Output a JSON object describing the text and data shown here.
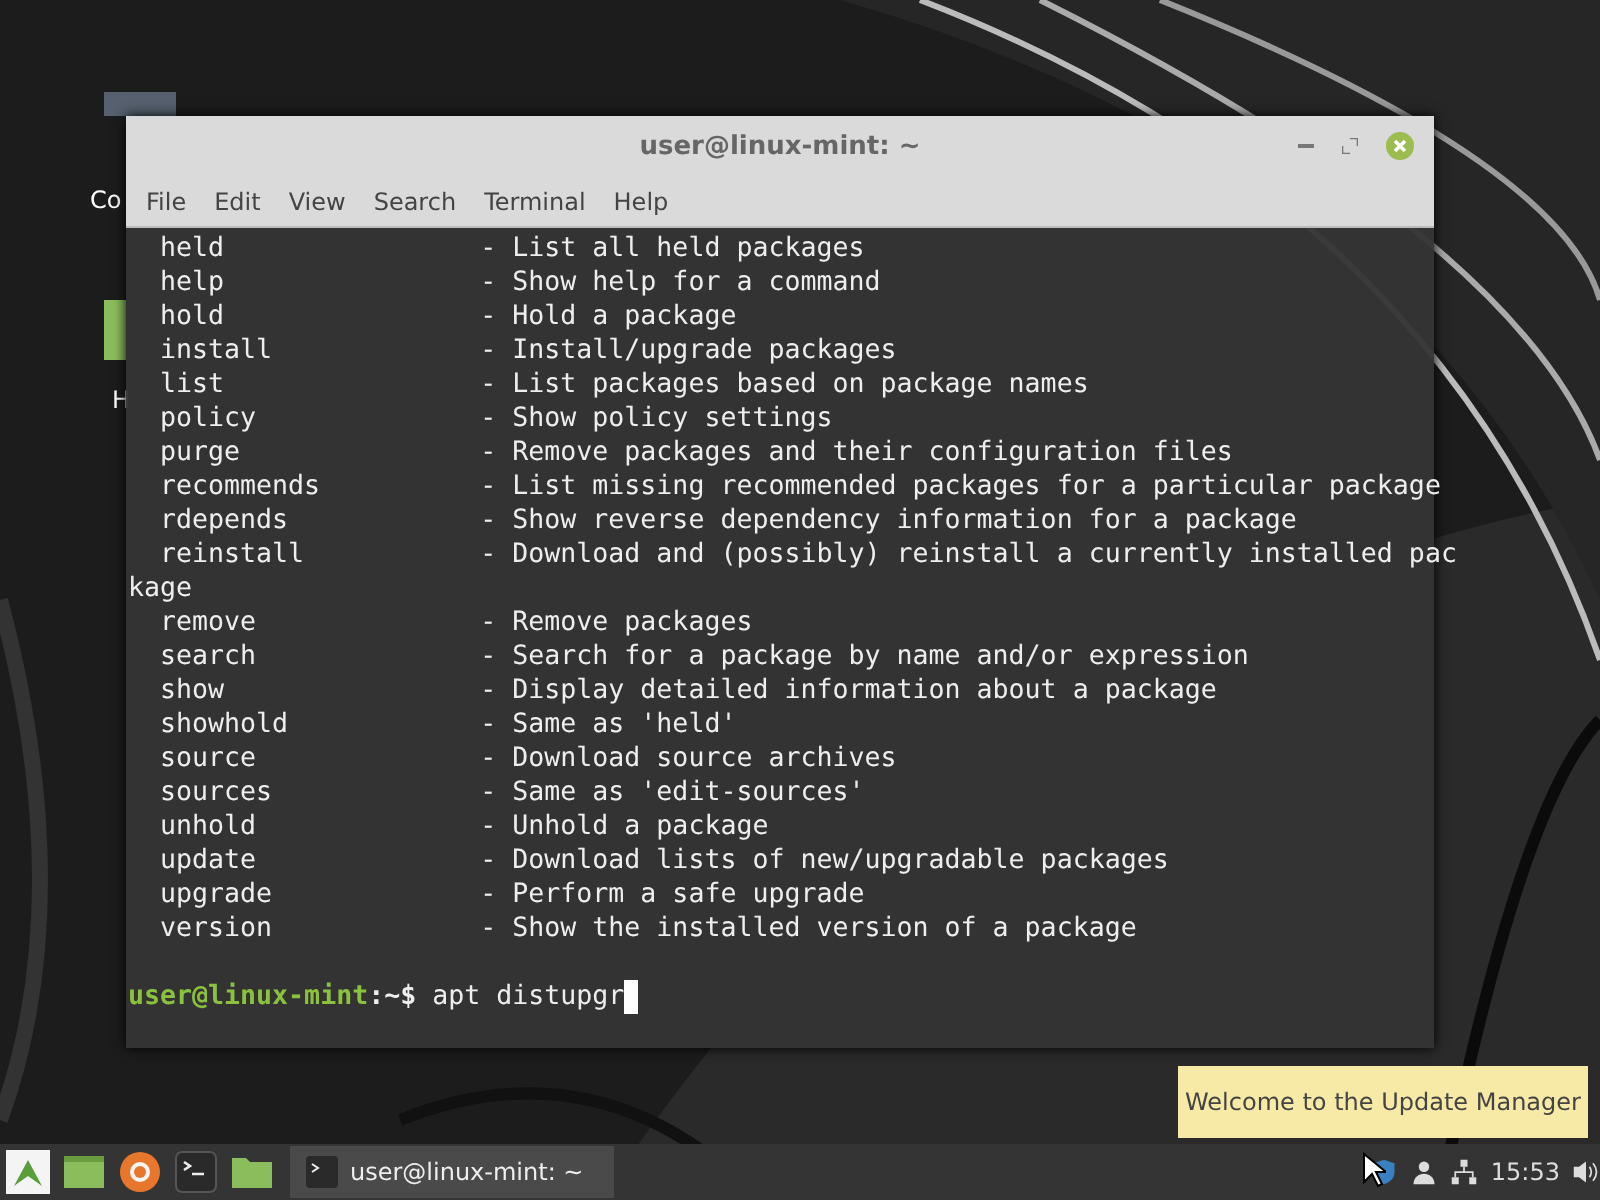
{
  "desktop_icons": [
    {
      "label": "Co"
    },
    {
      "label": "H"
    }
  ],
  "window": {
    "title": "user@linux-mint: ~",
    "active": true
  },
  "menu": [
    "File",
    "Edit",
    "View",
    "Search",
    "Terminal",
    "Help"
  ],
  "terminal": {
    "lines": [
      "  held                - List all held packages",
      "  help                - Show help for a command",
      "  hold                - Hold a package",
      "  install             - Install/upgrade packages",
      "  list                - List packages based on package names",
      "  policy              - Show policy settings",
      "  purge               - Remove packages and their configuration files",
      "  recommends          - List missing recommended packages for a particular package",
      "  rdepends            - Show reverse dependency information for a package",
      "  reinstall           - Download and (possibly) reinstall a currently installed pac",
      "kage",
      "  remove              - Remove packages",
      "  search              - Search for a package by name and/or expression",
      "  show                - Display detailed information about a package",
      "  showhold            - Same as 'held'",
      "  source              - Download source archives",
      "  sources             - Same as 'edit-sources'",
      "  unhold              - Unhold a package",
      "  update              - Download lists of new/upgradable packages",
      "  upgrade             - Perform a safe upgrade",
      "  version             - Show the installed version of a package"
    ],
    "prompt_user": "user@linux-mint",
    "prompt_path": ":~$",
    "command": "apt distupgr"
  },
  "tooltip": "Welcome to the Update Manager",
  "taskbar": {
    "launchers": [
      {
        "kind": "menu"
      },
      {
        "kind": "desktop"
      },
      {
        "kind": "browser"
      },
      {
        "kind": "terminal"
      },
      {
        "kind": "files"
      }
    ],
    "tasks": [
      {
        "label": "user@linux-mint: ~",
        "selected": true
      }
    ],
    "clock": "15:53"
  }
}
